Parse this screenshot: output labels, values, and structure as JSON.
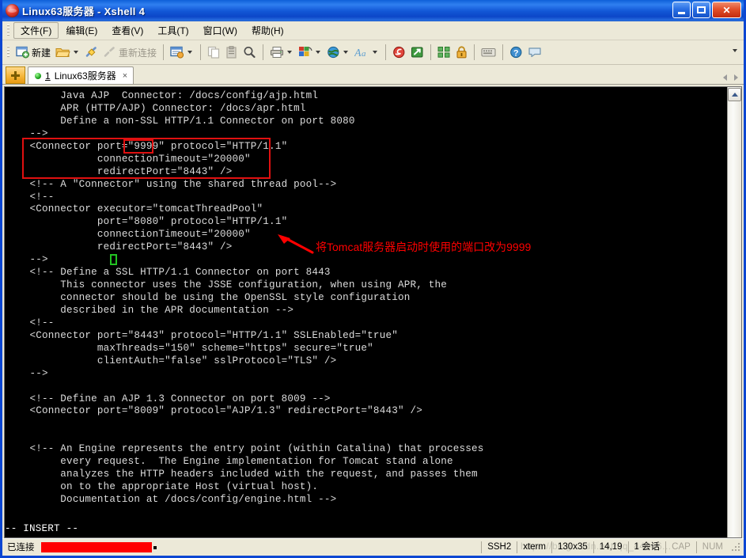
{
  "window": {
    "title": "Linux63服务器 - Xshell 4",
    "icon": "xshell-logo-icon",
    "minimize_label": "",
    "maximize_label": "",
    "close_label": "✕"
  },
  "menubar": {
    "items": [
      {
        "label": "文件(F)",
        "name": "menu-file"
      },
      {
        "label": "编辑(E)",
        "name": "menu-edit"
      },
      {
        "label": "查看(V)",
        "name": "menu-view"
      },
      {
        "label": "工具(T)",
        "name": "menu-tools"
      },
      {
        "label": "窗口(W)",
        "name": "menu-window"
      },
      {
        "label": "帮助(H)",
        "name": "menu-help"
      }
    ]
  },
  "toolbar": {
    "new_label": "新建",
    "reconnect_label": "重新连接",
    "overflow_label": "▾"
  },
  "tabbar": {
    "new_tab_label": "+",
    "tab_number": "1",
    "tab_title": "Linux63服务器",
    "close_label": "×"
  },
  "terminal": {
    "lines": [
      "       Java AJP  Connector: /docs/config/ajp.html",
      "       APR (HTTP/AJP) Connector: /docs/apr.html",
      "       Define a non-SSL HTTP/1.1 Connector on port 8080",
      "  -->",
      "  <Connector port=\"9999\" protocol=\"HTTP/1.1\"",
      "             connectionTimeout=\"20000\"",
      "             redirectPort=\"8443\" />",
      "  <!-- A \"Connector\" using the shared thread pool-->",
      "  <!--",
      "  <Connector executor=\"tomcatThreadPool\"",
      "             port=\"8080\" protocol=\"HTTP/1.1\"",
      "             connectionTimeout=\"20000\"",
      "             redirectPort=\"8443\" />",
      "  -->",
      "  <!-- Define a SSL HTTP/1.1 Connector on port 8443",
      "       This connector uses the JSSE configuration, when using APR, the",
      "       connector should be using the OpenSSL style configuration",
      "       described in the APR documentation -->",
      "  <!--",
      "  <Connector port=\"8443\" protocol=\"HTTP/1.1\" SSLEnabled=\"true\"",
      "             maxThreads=\"150\" scheme=\"https\" secure=\"true\"",
      "             clientAuth=\"false\" sslProtocol=\"TLS\" />",
      "  -->",
      "",
      "  <!-- Define an AJP 1.3 Connector on port 8009 -->",
      "  <Connector port=\"8009\" protocol=\"AJP/1.3\" redirectPort=\"8443\" />",
      "",
      "",
      "  <!-- An Engine represents the entry point (within Catalina) that processes",
      "       every request.  The Engine implementation for Tomcat stand alone",
      "       analyzes the HTTP headers included with the request, and passes them",
      "       on to the appropriate Host (virtual host).",
      "       Documentation at /docs/config/engine.html -->"
    ],
    "vim_status": "-- INSERT --",
    "scroll_up_label": "▲"
  },
  "annotation": {
    "text": "将Tomcat服务器启动时使用的端口改为9999",
    "color": "#ff0000",
    "highlight_value": "9999"
  },
  "statusbar": {
    "connection_label": "已连接",
    "redacted_host": "",
    "protocol": "SSH2",
    "term_type": "xterm",
    "size": "130x35",
    "cursor_pos": "14,19",
    "session_count": "1",
    "session_label": "会话",
    "caps_label": "CAP",
    "num_label": "NUM",
    "watermark": "https://blog.csdn.net/qq_44066..."
  }
}
